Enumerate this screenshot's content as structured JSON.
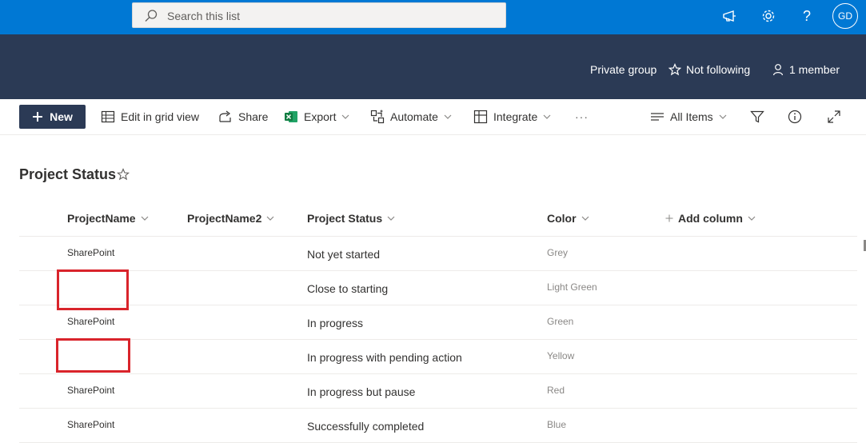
{
  "suite": {
    "search_placeholder": "Search this list",
    "avatar_initials": "GD",
    "accent_color": "#0078d4"
  },
  "site_header": {
    "privacy": "Private group",
    "follow_label": "Not following",
    "members": "1 member",
    "background_color": "#2b3a55"
  },
  "commands": {
    "new": "New",
    "edit_grid": "Edit in grid view",
    "share": "Share",
    "export": "Export",
    "automate": "Automate",
    "integrate": "Integrate",
    "more": "···",
    "view": "All Items"
  },
  "list": {
    "title": "Project Status",
    "columns": [
      "ProjectName",
      "ProjectName2",
      "Project Status",
      "Color",
      "Add column"
    ],
    "rows": [
      {
        "project_name": "SharePoint",
        "project_name2": "",
        "status": "Not yet started",
        "color": "Grey",
        "redacted": false
      },
      {
        "project_name": "",
        "project_name2": "",
        "status": "Close to starting",
        "color": "Light Green",
        "redacted": true
      },
      {
        "project_name": "SharePoint",
        "project_name2": "",
        "status": "In progress",
        "color": "Green",
        "redacted": false
      },
      {
        "project_name": "",
        "project_name2": "",
        "status": "In progress with pending action",
        "color": "Yellow",
        "redacted": true
      },
      {
        "project_name": "SharePoint",
        "project_name2": "",
        "status": "In progress but pause",
        "color": "Red",
        "redacted": false
      },
      {
        "project_name": "SharePoint",
        "project_name2": "",
        "status": "Successfully completed",
        "color": "Blue",
        "redacted": false
      }
    ]
  }
}
